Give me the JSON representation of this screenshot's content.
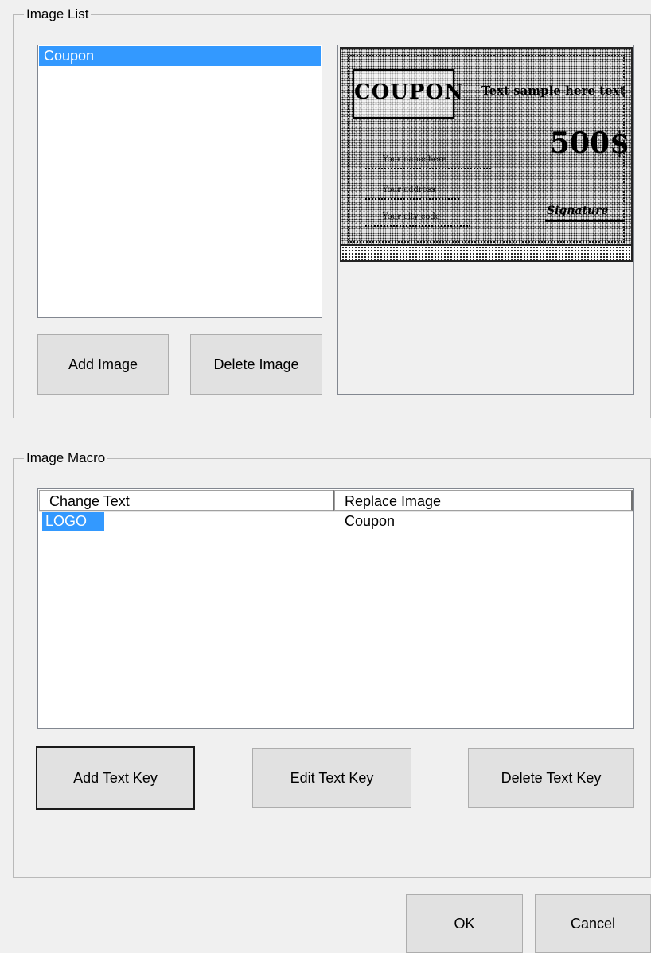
{
  "image_list": {
    "title": "Image List",
    "items": [
      {
        "label": "Coupon",
        "selected": true
      }
    ],
    "add_button": "Add Image",
    "delete_button": "Delete Image"
  },
  "preview": {
    "coupon_word": "COUPON",
    "tagline": "Text sample here text",
    "amount": "500$",
    "line1": "Your name here",
    "line2": "Your address",
    "line3": "Your city code",
    "signature": "Signature"
  },
  "image_macro": {
    "title": "Image Macro",
    "columns": [
      "Change Text",
      "Replace Image"
    ],
    "rows": [
      {
        "change_text": "LOGO",
        "replace_image": "Coupon",
        "selected": true
      }
    ],
    "add_button": "Add Text Key",
    "edit_button": "Edit Text Key",
    "delete_button": "Delete Text Key"
  },
  "dialog": {
    "ok_button": "OK",
    "cancel_button": "Cancel"
  },
  "colors": {
    "selection": "#3399ff",
    "window_bg": "#f0f0f0",
    "button_bg": "#e1e1e1"
  }
}
